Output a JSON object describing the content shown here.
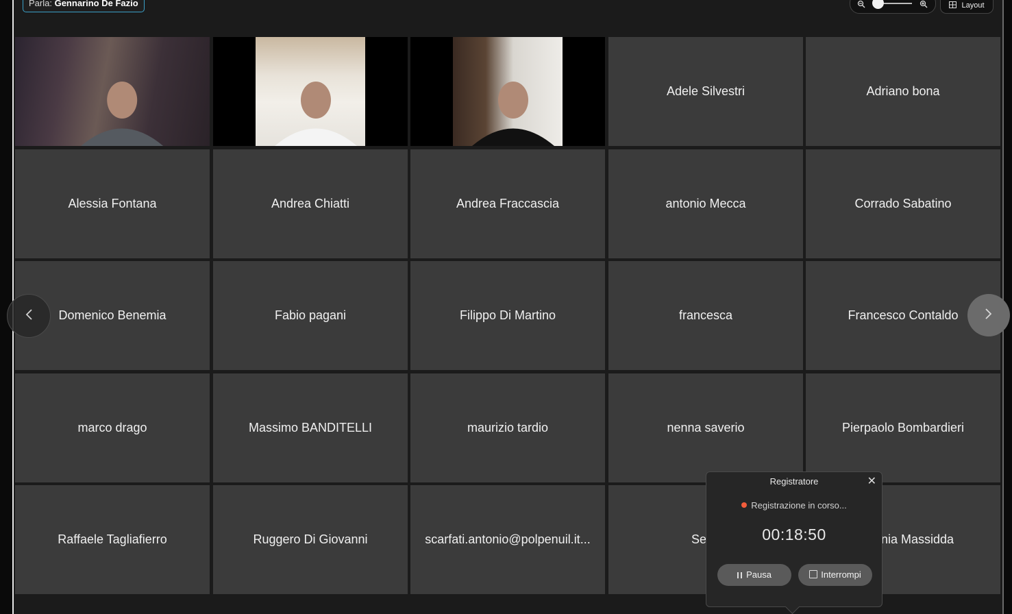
{
  "header": {
    "speaker_prefix": "Parla:",
    "speaker_name": "Gennarino De Fazio",
    "zoom_out_icon": "zoom-out-icon",
    "zoom_in_icon": "zoom-in-icon",
    "zoom_level": 0.1,
    "layout_label": "Layout"
  },
  "participants": [
    {
      "name": "",
      "video": true
    },
    {
      "name": "",
      "video": true
    },
    {
      "name": "",
      "video": true
    },
    {
      "name": "Adele Silvestri"
    },
    {
      "name": "Adriano bona"
    },
    {
      "name": "Alessia Fontana"
    },
    {
      "name": "Andrea Chiatti"
    },
    {
      "name": "Andrea Fraccascia"
    },
    {
      "name": "antonio Mecca"
    },
    {
      "name": "Corrado Sabatino"
    },
    {
      "name": "Domenico Benemia"
    },
    {
      "name": "Fabio pagani"
    },
    {
      "name": "Filippo Di Martino"
    },
    {
      "name": "francesca"
    },
    {
      "name": "Francesco Contaldo"
    },
    {
      "name": "marco drago"
    },
    {
      "name": "Massimo BANDITELLI"
    },
    {
      "name": "maurizio tardio"
    },
    {
      "name": "nenna saverio"
    },
    {
      "name": "Pierpaolo Bombardieri"
    },
    {
      "name": "Raffaele Tagliafierro"
    },
    {
      "name": "Ruggero Di Giovanni"
    },
    {
      "name": "scarfati.antonio@polpenuil.it..."
    },
    {
      "name": "Ser..."
    },
    {
      "name": "Stefania Massidda"
    }
  ],
  "navigation": {
    "prev_icon": "chevron-left-icon",
    "next_icon": "chevron-right-icon"
  },
  "recorder": {
    "title": "Registratore",
    "status": "Registrazione in corso...",
    "timer": "00:18:50",
    "pause_label": "Pausa",
    "stop_label": "Interrompi",
    "status_color": "#f25c3b"
  },
  "colors": {
    "tile_bg": "#3b3b3b",
    "accent": "#3aa0c8"
  }
}
